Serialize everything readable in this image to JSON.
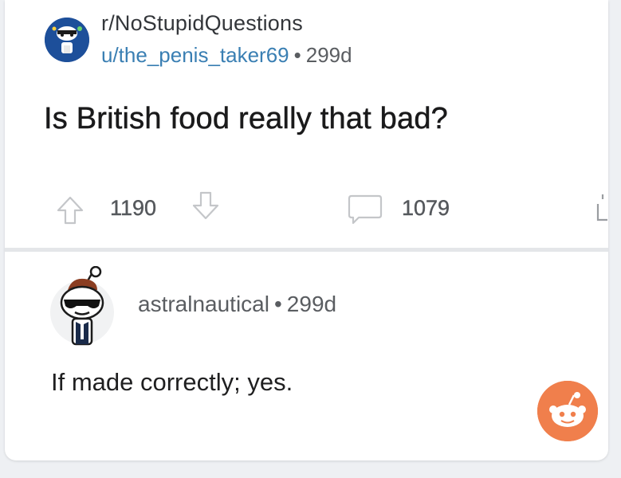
{
  "post": {
    "subreddit": "r/NoStupidQuestions",
    "author": "u/the_penis_taker69",
    "separator": "•",
    "age": "299d",
    "title": "Is British food really that bad?",
    "upvotes": "1190",
    "comments": "1079"
  },
  "comment": {
    "author": "astralnautical",
    "separator": "•",
    "age": "299d",
    "body": "If made correctly; yes."
  },
  "colors": {
    "accent_link": "#3a7fb3",
    "reddit_orange": "#f07f4c",
    "subreddit_avatar_bg": "#1d4f9a"
  },
  "icons": {
    "upvote": "arrow-up-outline",
    "downvote": "arrow-down-outline",
    "comments": "speech-bubble-outline",
    "share": "share-icon",
    "fab": "reddit-snoo"
  }
}
